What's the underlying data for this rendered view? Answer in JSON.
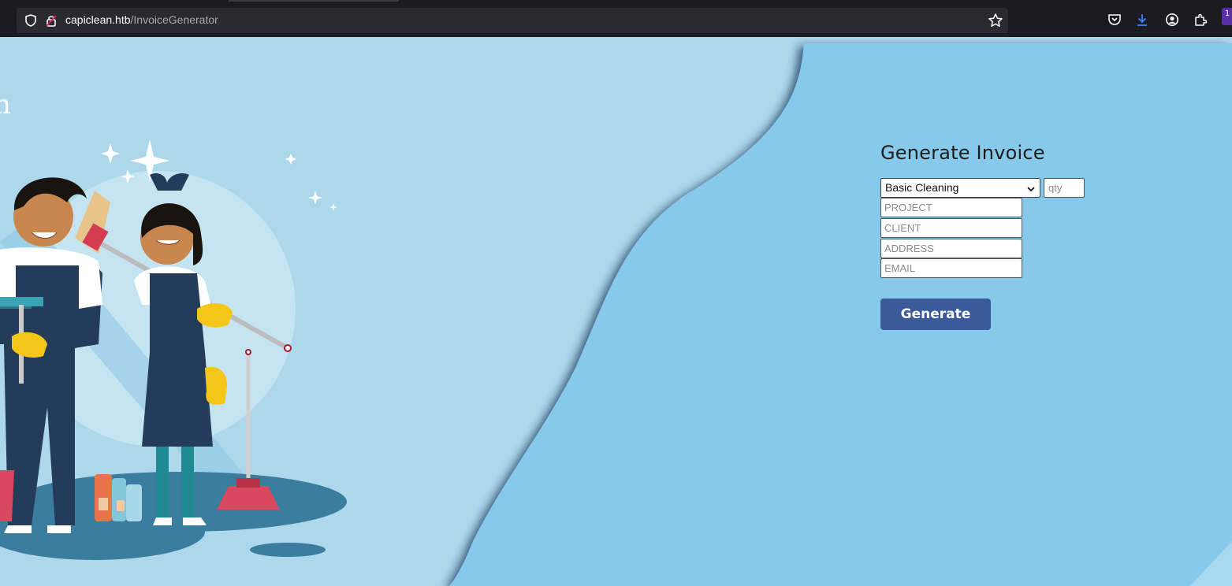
{
  "browser": {
    "url_host": "capiclean.htb",
    "url_path": "/InvoiceGenerator",
    "extension_badge": "1"
  },
  "hero": {
    "partial_letter": "n"
  },
  "form": {
    "title": "Generate Invoice",
    "service_select": {
      "selected": "Basic Cleaning"
    },
    "qty_placeholder": "qty",
    "project_placeholder": "PROJECT",
    "client_placeholder": "CLIENT",
    "address_placeholder": "ADDRESS",
    "email_placeholder": "EMAIL",
    "submit_label": "Generate"
  },
  "colors": {
    "page_left_bg": "#add8eb",
    "page_right_bg": "#87c9ea",
    "button_bg": "#3a5a99",
    "chrome_bg": "#1c1b22"
  }
}
